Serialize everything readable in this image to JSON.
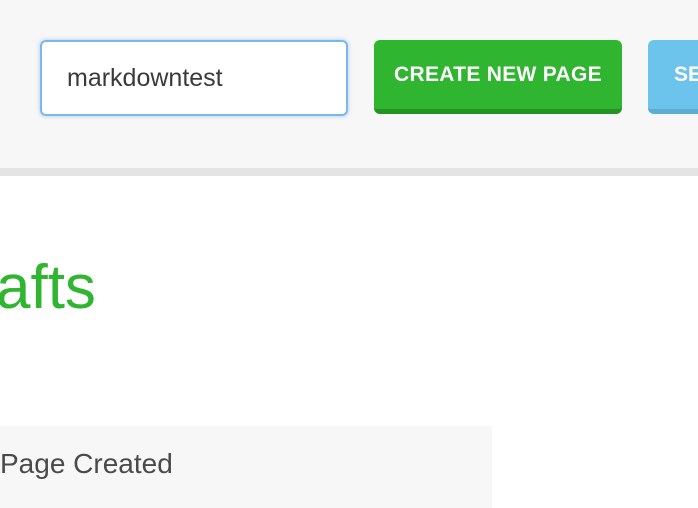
{
  "toolbar": {
    "page_name_value": "markdowntest",
    "create_button_label": "CREATE NEW PAGE",
    "search_button_label": "SE"
  },
  "main": {
    "section_heading": "afts",
    "table": {
      "columns": [
        "Page Created"
      ]
    }
  },
  "colors": {
    "accent_green": "#2fb52f",
    "accent_blue": "#6cc3ec",
    "input_focus_border": "#7db8ea"
  }
}
